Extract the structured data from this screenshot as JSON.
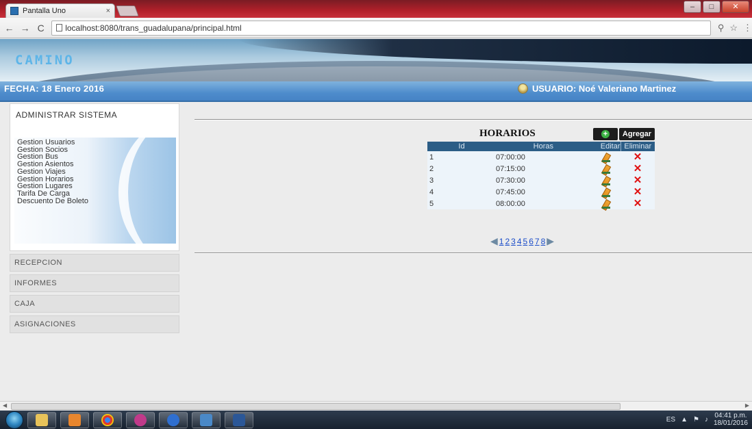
{
  "browser": {
    "tab_title": "Pantalla Uno",
    "tab_close": "×",
    "url": "localhost:8080/trans_guadalupana/principal.html",
    "window_controls": [
      "–",
      "□",
      "✕"
    ],
    "nav_icons": [
      "back-arrow-icon",
      "forward-arrow-icon",
      "reload-icon"
    ]
  },
  "header": {
    "logo_text": "CAMINO",
    "fecha": "FECHA:  18 Enero 2016",
    "usuario": "USUARIO:  Noé Valeriano Martinez"
  },
  "sidebar": {
    "admin_title": "ADMINISTRAR SISTEMA",
    "menu_items": [
      "Gestion Usuarios",
      "Gestion Socios",
      "Gestion Bus",
      "Gestion Asientos",
      "Gestion Viajes",
      "Gestion Horarios",
      "Gestion Lugares",
      "Tarifa De Carga",
      "Descuento De Boleto"
    ],
    "sections": [
      "RECEPCION",
      "INFORMES",
      "CAJA",
      "ASIGNACIONES"
    ]
  },
  "horarios": {
    "title": "HORARIOS",
    "add_label": "Agregar",
    "columns": [
      "Id",
      "Horas",
      "Editar",
      "Eliminar"
    ],
    "rows": [
      {
        "id": "1",
        "hora": "07:00:00"
      },
      {
        "id": "2",
        "hora": "07:15:00"
      },
      {
        "id": "3",
        "hora": "07:30:00"
      },
      {
        "id": "4",
        "hora": "07:45:00"
      },
      {
        "id": "5",
        "hora": "08:00:00"
      }
    ],
    "pages": [
      "1",
      "2",
      "3",
      "4",
      "5",
      "6",
      "7",
      "8"
    ]
  },
  "taskbar": {
    "tray_lang": "ES",
    "clock_time": "04:41 p.m.",
    "clock_date": "18/01/2016"
  },
  "colors": {
    "info_bar": "#4e8ccc",
    "table_header": "#2c5d86",
    "delete_red": "#e01010",
    "page_link": "#1a4cc9"
  }
}
